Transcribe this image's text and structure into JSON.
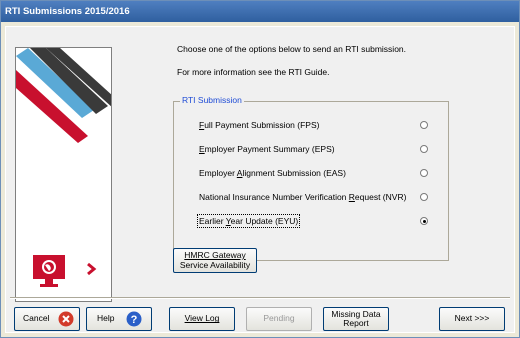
{
  "window": {
    "title": "RTI Submissions 2015/2016"
  },
  "intro": {
    "line1": "Choose one of the options below to send an RTI submission.",
    "line2": "For more information see the RTI Guide."
  },
  "group": {
    "label": "RTI Submission",
    "options": [
      {
        "pre": "",
        "u": "F",
        "post": "ull Payment Submission (FPS)",
        "selected": false
      },
      {
        "pre": "",
        "u": "E",
        "post": "mployer Payment Summary (EPS)",
        "selected": false
      },
      {
        "pre": "Employer ",
        "u": "A",
        "post": "lignment Submission (EAS)",
        "selected": false
      },
      {
        "pre": "National Insurance Number Verification ",
        "u": "R",
        "post": "equest (NVR)",
        "selected": false
      },
      {
        "pre": "Earlier ",
        "u": "Y",
        "post": "ear Update (EYU)",
        "selected": true
      }
    ]
  },
  "gateway_button": {
    "line1": "HMRC Gateway",
    "line2": "Service Availability"
  },
  "buttons": {
    "cancel": "Cancel",
    "help": "Help",
    "view_log": "View Log",
    "pending": "Pending",
    "missing_line1": "Missing Data",
    "missing_line2": "Report",
    "next": "Next >>>"
  },
  "icons": {
    "cancel": "cancel-x-icon",
    "help": "help-question-icon",
    "side": "monitor-globe-icon",
    "arrow": "chevron-right-icon"
  },
  "colors": {
    "title_bar": "#3a6cb0",
    "group_label": "#1f4cd6",
    "brand_red": "#c8102e",
    "brand_blue": "#5aa9d6",
    "brand_dark": "#3a3a3a"
  }
}
